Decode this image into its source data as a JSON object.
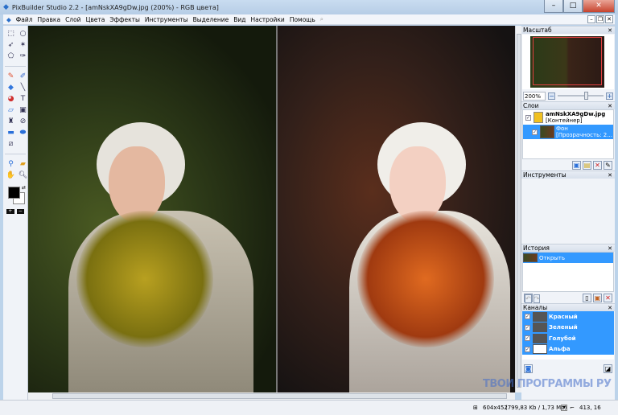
{
  "window": {
    "title": "PixBuilder Studio 2.2 - [amNskXA9gDw.jpg (200%) - RGB цвета]",
    "minimize": "–",
    "maximize": "□",
    "close": "✕"
  },
  "menu": [
    "Файл",
    "Правка",
    "Слой",
    "Цвета",
    "Эффекты",
    "Инструменты",
    "Выделение",
    "Вид",
    "Настройки",
    "Помощь"
  ],
  "toolbox": {
    "tools": [
      "rect-select",
      "lasso",
      "move",
      "magic-wand",
      "poly-lasso",
      "magnetic-lasso",
      "pencil",
      "brush",
      "eraser",
      "line",
      "fill-bucket",
      "text",
      "gradient-eraser",
      "stamp-brush",
      "clone-stamp",
      "healing",
      "rectangle-shape",
      "ellipse-shape",
      "crop",
      "eyedropper",
      "ruler",
      "hand",
      "zoom"
    ],
    "foreground_color": "#000000",
    "background_color": "#ffffff"
  },
  "panels": {
    "navigator": {
      "title": "Масштаб",
      "zoom_value": "200%",
      "zoom_slider": 0.58
    },
    "layers": {
      "title": "Слои",
      "items": [
        {
          "name": "amNskXA9gDw.jpg",
          "sub": "[Контейнер]",
          "selected": false
        },
        {
          "name": "Фон",
          "sub": "[Прозрачность: 2...",
          "selected": true
        }
      ]
    },
    "tools": {
      "title": "Инструменты"
    },
    "history": {
      "title": "История",
      "items": [
        "Открыть"
      ]
    },
    "channels": {
      "title": "Каналы",
      "items": [
        "Красный",
        "Зеленый",
        "Голубой",
        "Альфа"
      ]
    }
  },
  "status": {
    "size": "604x452",
    "memory": "(799,83 Kb / 1,73 Mb)",
    "coords": "413, 16"
  },
  "watermark": "ТВОИ ПРОГРАММЫ РУ",
  "colors": {
    "selection": "#3399ff",
    "close": "#c7432d"
  }
}
